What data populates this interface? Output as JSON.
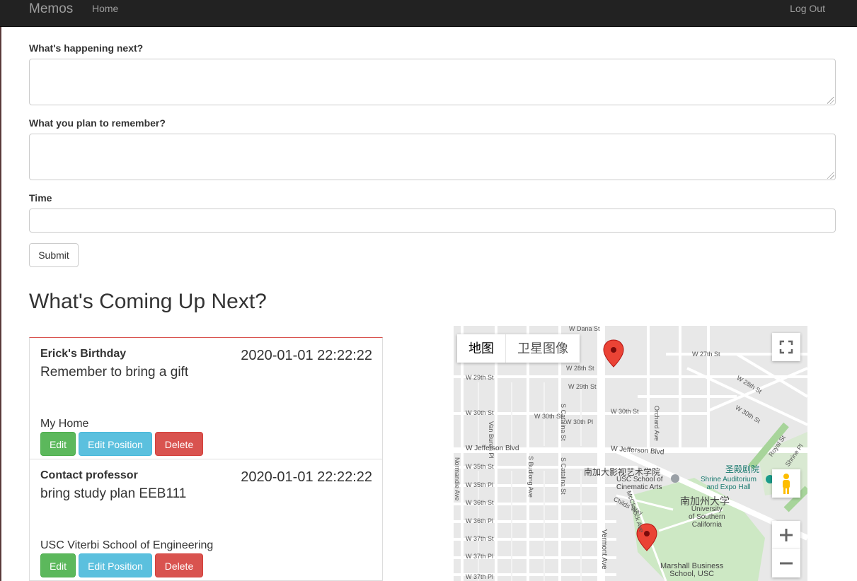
{
  "navbar": {
    "brand": "Memos",
    "home": "Home",
    "logout": "Log Out"
  },
  "form": {
    "field1_label": "What's happening next?",
    "field1_value": "",
    "field2_label": "What you plan to remember?",
    "field2_value": "",
    "time_label": "Time",
    "time_value": "",
    "submit_label": "Submit"
  },
  "section_title": "What's Coming Up Next?",
  "memos": [
    {
      "title": "Erick's Birthday",
      "time": "2020-01-01 22:22:22",
      "description": "Remember to bring a gift",
      "location": "My Home",
      "edit_label": "Edit",
      "edit_position_label": "Edit Position",
      "delete_label": "Delete"
    },
    {
      "title": "Contact professor",
      "time": "2020-01-01 22:22:22",
      "description": "bring study plan EEB111",
      "location": "USC Viterbi School of Engineering",
      "edit_label": "Edit",
      "edit_position_label": "Edit Position",
      "delete_label": "Delete"
    }
  ],
  "map": {
    "type_map": "地图",
    "type_satellite": "卫星图像",
    "labels": {
      "dana": "W Dana St",
      "s27": "W 27th St",
      "s28": "W 28th St",
      "s29a": "W 29th St",
      "s29b": "W 29th St",
      "s28b": "W 28th St",
      "s30a": "W 30th St",
      "s30b": "W 30th St",
      "s30c": "W 30th St",
      "s30pl": "W 30th Pl",
      "s30d": "W 30th St",
      "jeff1": "W Jefferson Blvd",
      "jeff2": "W Jefferson Blvd",
      "s35": "W 35th St",
      "s35pl": "W 35th Pl",
      "s36": "W 36th St",
      "s36pl": "W 36th Pl",
      "s37": "W 37th St",
      "s37pl": "W 37th Pl",
      "s37pl2": "W 37th Pl",
      "vanburen": "Van Buren Pl",
      "budlong": "S Budlong Ave",
      "catalina": "S Catalina St",
      "catalina2": "S Catalina St",
      "normandie": "Normandie Ave",
      "orchard": "Orchard Ave",
      "vermont": "Vermont Ave",
      "mcclintock": "McClintock Ave",
      "childs": "Childs Way",
      "royal": "Royal St",
      "shrinepl": "Shrine Pl",
      "cinematic_cn": "南加大影视艺术学院",
      "cinematic": "USC School of\nCinematic Arts",
      "shrine_cn": "圣殿剧院",
      "shrine": "Shrine Auditorium\nand Expo Hall",
      "usc_cn": "南加州大学",
      "usc": "University\nof Southern\nCalifornia",
      "marshall": "Marshall Business\nSchool, USC"
    }
  }
}
